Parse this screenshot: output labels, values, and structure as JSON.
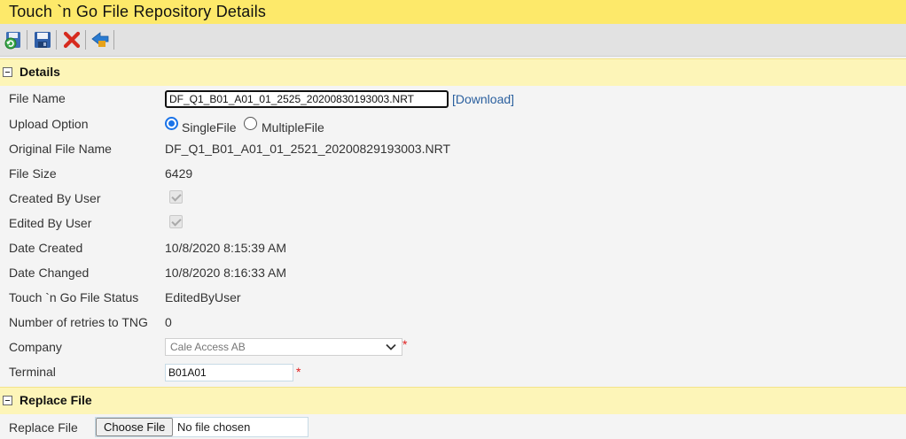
{
  "window": {
    "title": "Touch `n Go File Repository Details"
  },
  "toolbar": {
    "buttons": [
      {
        "icon": "save-and-new-icon"
      },
      {
        "icon": "save-icon"
      },
      {
        "icon": "delete-icon"
      },
      {
        "icon": "back-icon"
      }
    ]
  },
  "details": {
    "header": "Details",
    "file_name": {
      "label": "File Name",
      "value": "DF_Q1_B01_A01_01_2525_20200830193003.NRT",
      "link": "[Download]"
    },
    "upload_option": {
      "label": "Upload Option",
      "options": [
        "SingleFile",
        "MultipleFile"
      ],
      "selected": "SingleFile"
    },
    "original_file_name": {
      "label": "Original File Name",
      "value": "DF_Q1_B01_A01_01_2521_20200829193003.NRT"
    },
    "file_size": {
      "label": "File Size",
      "value": "6429"
    },
    "created_by_user": {
      "label": "Created By User",
      "checked": true
    },
    "edited_by_user": {
      "label": "Edited By User",
      "checked": true
    },
    "date_created": {
      "label": "Date Created",
      "value": "10/8/2020 8:15:39 AM"
    },
    "date_changed": {
      "label": "Date Changed",
      "value": "10/8/2020 8:16:33 AM"
    },
    "tng_status": {
      "label": "Touch `n Go File Status",
      "value": "EditedByUser"
    },
    "retries": {
      "label": "Number of retries to TNG",
      "value": "0"
    },
    "company": {
      "label": "Company",
      "value": "Cale Access AB",
      "required_mark": "*"
    },
    "terminal": {
      "label": "Terminal",
      "value": "B01A01",
      "required_mark": "*"
    }
  },
  "replace": {
    "header": "Replace File",
    "label": "Replace File",
    "button": "Choose File",
    "status": "No file chosen"
  },
  "colors": {
    "title_bar": "#fde96a",
    "section_header": "#fdf5b8",
    "toolbar": "#e2e2e2",
    "link": "#2a5f9e",
    "required": "#e02020",
    "radio_accent": "#1a73e8"
  }
}
